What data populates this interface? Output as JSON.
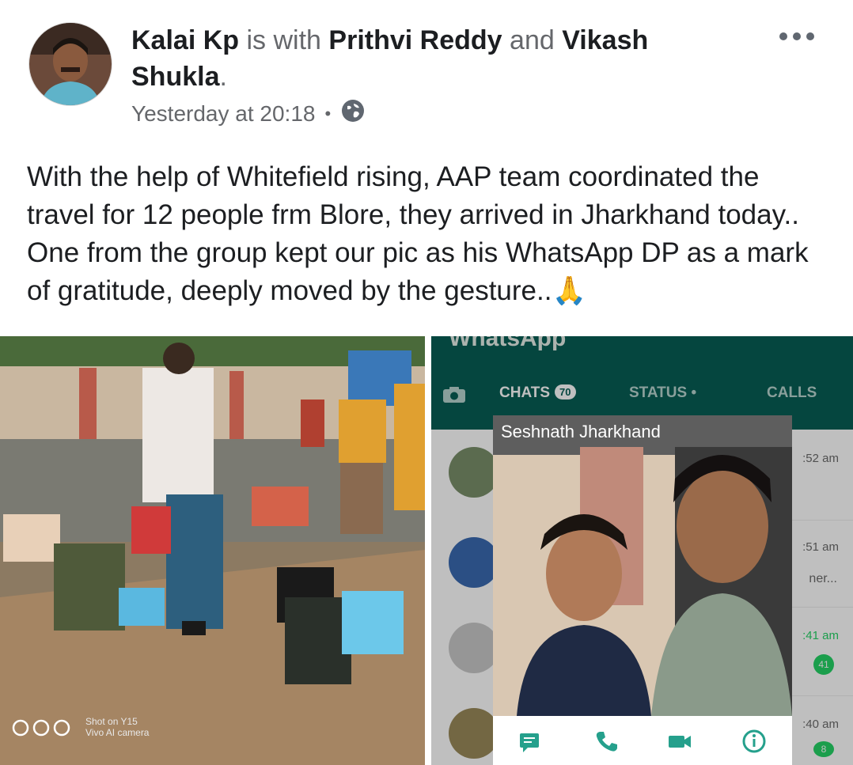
{
  "author": "Kalai Kp",
  "with_connector": "is with",
  "tagged": [
    "Prithvi Reddy",
    "Vikash Shukla"
  ],
  "and_word": "and",
  "timestamp": "Yesterday at 20:18",
  "audience_icon": "globe-icon",
  "post_text": "With the help of Whitefield rising, AAP team coordinated the travel for 12 people frm Blore, they arrived in Jharkhand today.. One from the group kept our pic as his WhatsApp DP as a mark of gratitude, deeply moved by the gesture..",
  "post_emoji": "🙏",
  "photo_watermark": {
    "line1": "Shot on Y15",
    "line2": "Vivo AI camera"
  },
  "whatsapp": {
    "app_title": "WhatsApp",
    "tabs": [
      {
        "label": "CHATS",
        "badge": "70"
      },
      {
        "label": "STATUS •"
      },
      {
        "label": "CALLS"
      }
    ],
    "chat_times": [
      ":52 am",
      ":51 am",
      ":41 am",
      ":40 am"
    ],
    "chat_snippet": "ner...",
    "unread_counts": [
      "41",
      "8"
    ],
    "profile_overlay": {
      "name": "Seshnath Jharkhand",
      "actions": [
        "message-icon",
        "call-icon",
        "video-icon",
        "info-icon"
      ]
    }
  },
  "colors": {
    "whatsapp_green": "#075e54",
    "accent_green": "#25d366",
    "text": "#1c1e21",
    "muted": "#65676b"
  }
}
